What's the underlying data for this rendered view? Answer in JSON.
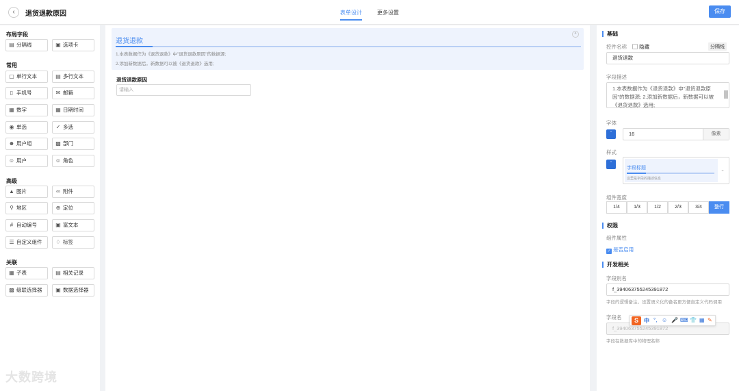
{
  "header": {
    "title": "退货退款原因",
    "tabs": [
      {
        "label": "表单设计",
        "active": true
      },
      {
        "label": "更多设置",
        "active": false
      }
    ],
    "save_label": "保存"
  },
  "left": {
    "groups": [
      {
        "title": "布局字段",
        "items": [
          {
            "label": "分隔线",
            "icon": "divider-icon"
          },
          {
            "label": "选项卡",
            "icon": "tab-icon"
          }
        ]
      },
      {
        "title": "常用",
        "items": [
          {
            "label": "单行文本",
            "icon": "text-icon"
          },
          {
            "label": "多行文本",
            "icon": "textarea-icon"
          },
          {
            "label": "手机号",
            "icon": "phone-icon"
          },
          {
            "label": "邮箱",
            "icon": "mail-icon"
          },
          {
            "label": "数字",
            "icon": "number-icon"
          },
          {
            "label": "日期时间",
            "icon": "calendar-icon"
          },
          {
            "label": "单选",
            "icon": "radio-icon"
          },
          {
            "label": "多选",
            "icon": "checkbox-icon"
          },
          {
            "label": "用户组",
            "icon": "user-group-icon"
          },
          {
            "label": "部门",
            "icon": "department-icon"
          },
          {
            "label": "用户",
            "icon": "user-icon"
          },
          {
            "label": "角色",
            "icon": "role-icon"
          }
        ]
      },
      {
        "title": "高级",
        "items": [
          {
            "label": "图片",
            "icon": "image-icon"
          },
          {
            "label": "附件",
            "icon": "attachment-icon"
          },
          {
            "label": "地区",
            "icon": "region-icon"
          },
          {
            "label": "定位",
            "icon": "location-icon"
          },
          {
            "label": "自动编号",
            "icon": "hash-icon"
          },
          {
            "label": "富文本",
            "icon": "rich-text-icon"
          },
          {
            "label": "自定义组件",
            "icon": "layers-icon"
          },
          {
            "label": "标签",
            "icon": "tag-icon"
          }
        ]
      },
      {
        "title": "关联",
        "items": [
          {
            "label": "子表",
            "icon": "table-icon"
          },
          {
            "label": "相关记录",
            "icon": "records-icon"
          },
          {
            "label": "级联选择器",
            "icon": "cascade-icon"
          },
          {
            "label": "数据选择器",
            "icon": "data-select-icon"
          }
        ]
      }
    ],
    "watermark": "大数跨境"
  },
  "canvas": {
    "desc_title": "退货退款",
    "desc_line1": "1.本表数据作为《退货退款》中\"退货退款原因\"的数据源;",
    "desc_line2": "2.添加新数据后，新数据可以被《退货退款》选用;",
    "field_label": "退货退款原因",
    "field_placeholder": "请输入"
  },
  "right": {
    "basic": {
      "title": "基础",
      "name_label": "控件名称",
      "hide_label": "隐藏",
      "type_tag": "分隔线",
      "name_value": "退货退款",
      "desc_label": "字段描述",
      "desc_value": "1.本表数据作为《退货退款》中\"退货退款原因\"的数据源;\n2.添加新数据后，新数据可以被《退货退款》选用;",
      "font_label": "字体",
      "font_size": "16",
      "font_unit": "像素",
      "style_label": "样式",
      "style_preview_title": "字段标题",
      "style_preview_desc": "这里是字段的描述信息",
      "width_label": "组件宽度",
      "widths": [
        {
          "label": "1/4",
          "active": false
        },
        {
          "label": "1/3",
          "active": false
        },
        {
          "label": "1/2",
          "active": false
        },
        {
          "label": "2/3",
          "active": false
        },
        {
          "label": "3/4",
          "active": false
        },
        {
          "label": "整行",
          "active": true
        }
      ]
    },
    "permission": {
      "title": "权限",
      "attr_label": "组件属性",
      "enabled_label": "是否启用",
      "enabled": true
    },
    "dev": {
      "title": "开发相关",
      "alias_label": "字段别名",
      "alias_value": "f_394063755245391872",
      "alias_hint": "字段的逻辑备注，设置语义化的备名更方便自定义代码调用",
      "name_label": "字段名",
      "name_value": "f_394063755245391872",
      "name_hint": "字段在数据库中的物理名称"
    }
  },
  "ime": {
    "logo": "S",
    "items": [
      "中",
      "°,",
      "☺",
      "🎤",
      "⌨",
      "👕",
      "▦",
      "✎"
    ]
  },
  "colors": {
    "accent": "#4a8cf0",
    "ime": "#f26522"
  }
}
